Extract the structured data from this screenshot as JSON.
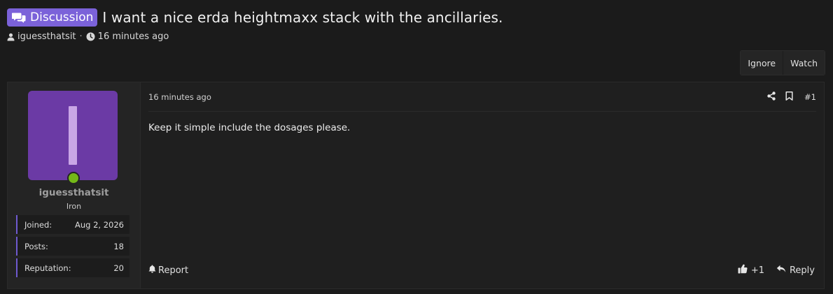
{
  "thread": {
    "prefix": "Discussion",
    "title": "I want a nice erda heightmaxx stack with the ancillaries.",
    "author": "iguessthatsit",
    "separator": "·",
    "time": "16 minutes ago"
  },
  "actions": {
    "ignore_label": "Ignore",
    "watch_label": "Watch"
  },
  "post": {
    "date": "16 minutes ago",
    "number": "#1",
    "body": "Keep it simple include the dosages please.",
    "report_label": "Report",
    "like_count": "+1",
    "reply_label": "Reply"
  },
  "user": {
    "name": "iguessthatsit",
    "title": "Iron",
    "online": true,
    "avatar_color": "#6b3aa5",
    "stats": {
      "joined_label": "Joined:",
      "joined_value": "Aug 2, 2026",
      "posts_label": "Posts:",
      "posts_value": "18",
      "rep_label": "Reputation:",
      "rep_value": "20"
    }
  },
  "colors": {
    "accent": "#7b62d9",
    "online": "#74b818",
    "background": "#1b1b1b"
  },
  "icons": [
    "comments-icon",
    "user-icon",
    "clock-icon",
    "share-icon",
    "bookmark-icon",
    "bell-icon",
    "thumbs-up-icon",
    "reply-icon"
  ]
}
